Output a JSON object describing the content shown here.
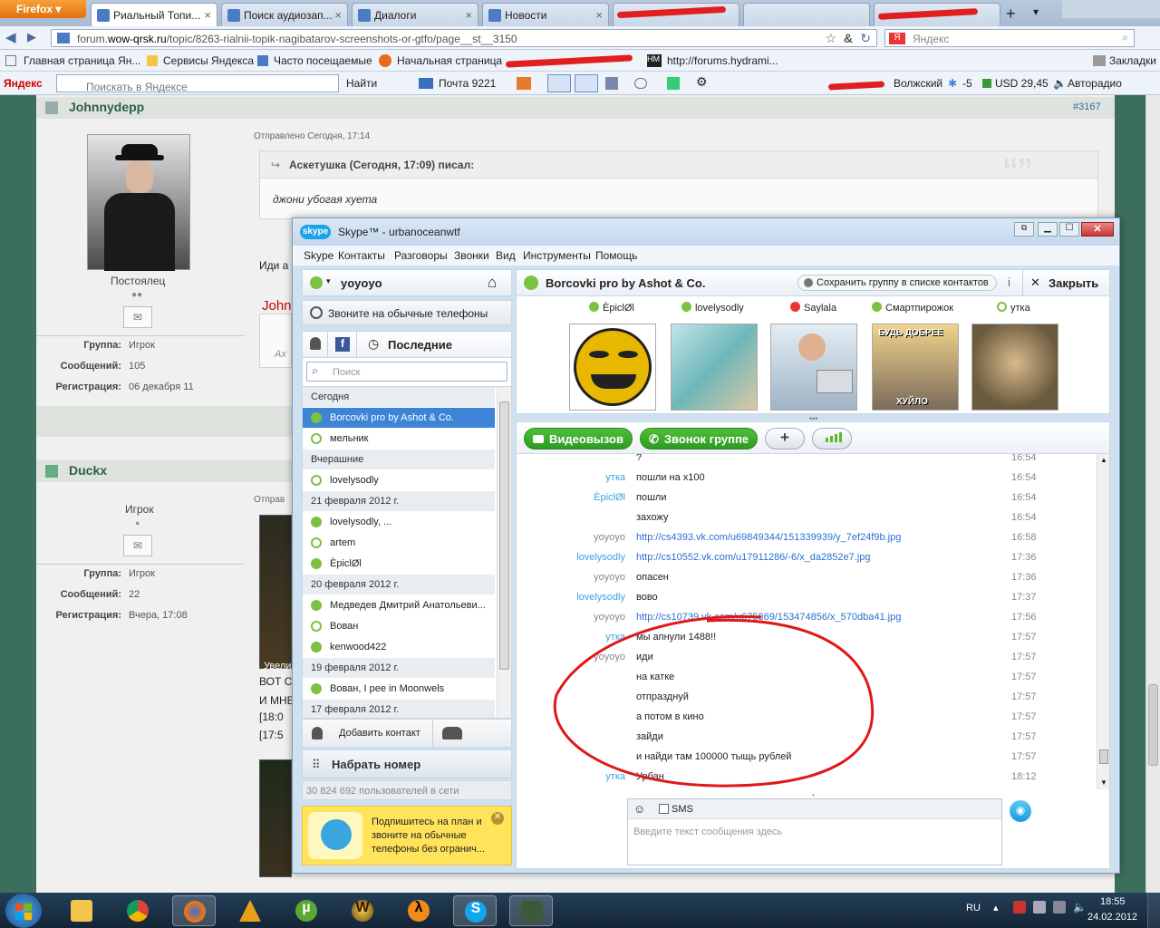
{
  "browser": {
    "menu_button": "Firefox",
    "tabs": [
      {
        "label": "Риальный Топи...",
        "active": true
      },
      {
        "label": "Поиск аудиозап..."
      },
      {
        "label": "Диалоги"
      },
      {
        "label": "Новости"
      }
    ],
    "url_prefix": "forum.",
    "url_domain": "wow-qrsk.ru",
    "url_path": "/topic/8263-rialnii-topik-nagibatarov-screenshots-or-gtfo/page__st__3150",
    "search_placeholder": "Яндекс",
    "bookmarks": [
      "Главная страница Ян...",
      "Сервисы Яндекса",
      "Часто посещаемые",
      "Начальная страница",
      "http://forums.hydrami...",
      "Закладки"
    ],
    "yandex_label": "Яндекс",
    "yandex_search_placeholder": "Поискать в Яндексе",
    "find_label": "Найти",
    "mail_label": "Почта 9221",
    "city": "Волжский",
    "temperature": "-5",
    "usd": "USD 29,45",
    "radio": "Авторадио"
  },
  "forum": {
    "post1": {
      "username": "Johnnydepp",
      "post_id": "#3167",
      "posted": "Отправлено Сегодня, 17:14",
      "quote_header": "Аскетушка (Сегодня, 17:09) писал:",
      "quote_text": "джони убогая хуета",
      "partial_text": "Иди а",
      "partial_name": "John",
      "partial_quote": "Ах",
      "rank": "Постоялец",
      "group_label": "Группа:",
      "group": "Игрок",
      "posts_label": "Сообщений:",
      "posts": "105",
      "reg_label": "Регистрация:",
      "reg": "06 декабря 11"
    },
    "post2": {
      "username": "Duckx",
      "posted": "Отправ",
      "rank": "Игрок",
      "group_label": "Группа:",
      "group": "Игрок",
      "posts_label": "Сообщений:",
      "posts": "22",
      "reg_label": "Регистрация:",
      "reg": "Вчера, 17:08",
      "partial_lines": [
        "Увели",
        "ВОТ С",
        "И МНЕ",
        "[18:0",
        "[17:5"
      ]
    }
  },
  "skype": {
    "title": "Skype™ - urbanoceanwtf",
    "menu": [
      "Skype",
      "Контакты",
      "Разговоры",
      "Звонки",
      "Вид",
      "Инструменты",
      "Помощь"
    ],
    "user": "yoyoyo",
    "call_phones": "Звоните на обычные телефоны",
    "recent_tab": "Последние",
    "search_placeholder": "Поиск",
    "list": [
      {
        "type": "hdr",
        "text": "Сегодня"
      },
      {
        "type": "item",
        "text": "Borcovki pro by Ashot & Co.",
        "selected": true,
        "group": true
      },
      {
        "type": "item",
        "text": "мельник"
      },
      {
        "type": "hdr",
        "text": "Вчерашние"
      },
      {
        "type": "item",
        "text": "lovelysodly"
      },
      {
        "type": "hdr",
        "text": "21 февраля 2012 г."
      },
      {
        "type": "item",
        "text": "lovelysodly, ...",
        "group": true
      },
      {
        "type": "item",
        "text": "artem"
      },
      {
        "type": "item",
        "text": "ÈpiclØl",
        "on": true
      },
      {
        "type": "hdr",
        "text": "20 февраля 2012 г."
      },
      {
        "type": "item",
        "text": "Медведев Дмитрий Анатольеви...",
        "group": true
      },
      {
        "type": "item",
        "text": "Вован"
      },
      {
        "type": "item",
        "text": "kenwood422",
        "on": true
      },
      {
        "type": "hdr",
        "text": "19 февраля 2012 г."
      },
      {
        "type": "item",
        "text": "Вован, I pee in Moonwels",
        "group": true
      },
      {
        "type": "hdr",
        "text": "17 февраля 2012 г."
      }
    ],
    "add_contact": "Добавить контакт",
    "dial": "Набрать номер",
    "online_count": "30 824 692 пользователей в сети",
    "promo": "Подпишитесь на план и звоните на обычные телефоны без огранич...",
    "conv_title": "Borcovki pro by Ashot & Co.",
    "save_group": "Сохранить группу в списке контактов",
    "close": "Закрыть",
    "participants": [
      {
        "name": "ÈpiclØl",
        "status": "online"
      },
      {
        "name": "lovelysodly",
        "status": "online"
      },
      {
        "name": "Saylala",
        "status": "busy"
      },
      {
        "name": "Смартпирожок",
        "status": "online"
      },
      {
        "name": "утка",
        "status": "away"
      }
    ],
    "pic4_text_top": "БУДЬ ДОБРЕЕ",
    "pic4_text_bottom": "ХУЙЛО",
    "video_call": "Видеовызов",
    "group_call": "Звонок группе",
    "messages": [
      {
        "who": "",
        "text": "?",
        "time": "16:54",
        "blue": false
      },
      {
        "who": "утка",
        "text": "пошли на х100",
        "time": "16:54",
        "blue": true
      },
      {
        "who": "ÈpiclØl",
        "text": "пошли",
        "time": "16:54",
        "blue": true
      },
      {
        "who": "",
        "text": "захожу",
        "time": "16:54",
        "blue": true
      },
      {
        "who": "yoyoyo",
        "text": "http://cs4393.vk.com/u69849344/151339939/y_7ef24f9b.jpg",
        "time": "16:58",
        "link": true
      },
      {
        "who": "lovelysodly",
        "text": "http://cs10552.vk.com/u17911286/-6/x_da2852e7.jpg",
        "time": "17:36",
        "blue": true,
        "link": true
      },
      {
        "who": "yoyoyo",
        "text": "опасен",
        "time": "17:36"
      },
      {
        "who": "lovelysodly",
        "text": "вово",
        "time": "17:37",
        "blue": true
      },
      {
        "who": "yoyoyo",
        "text": "http://cs10739.vk.com/u675869/153474856/x_570dba41.jpg",
        "time": "17:56",
        "link": true
      },
      {
        "who": "утка",
        "text": "мы апнули 1488!!",
        "time": "17:57",
        "blue": true
      },
      {
        "who": "yoyoyo",
        "text": "иди",
        "time": "17:57"
      },
      {
        "who": "",
        "text": "на катке",
        "time": "17:57"
      },
      {
        "who": "",
        "text": "отпразднуй",
        "time": "17:57"
      },
      {
        "who": "",
        "text": "а потом в кино",
        "time": "17:57"
      },
      {
        "who": "",
        "text": "зайди",
        "time": "17:57"
      },
      {
        "who": "",
        "text": "и найди там 100000 тыщь рублей",
        "time": "17:57"
      },
      {
        "who": "утка",
        "text": "Урбан",
        "time": "18:12",
        "blue": true
      }
    ],
    "sms_label": "SMS",
    "input_placeholder": "Введите текст сообщения здесь"
  },
  "taskbar": {
    "lang": "RU",
    "time": "18:55",
    "date": "24.02.2012"
  }
}
